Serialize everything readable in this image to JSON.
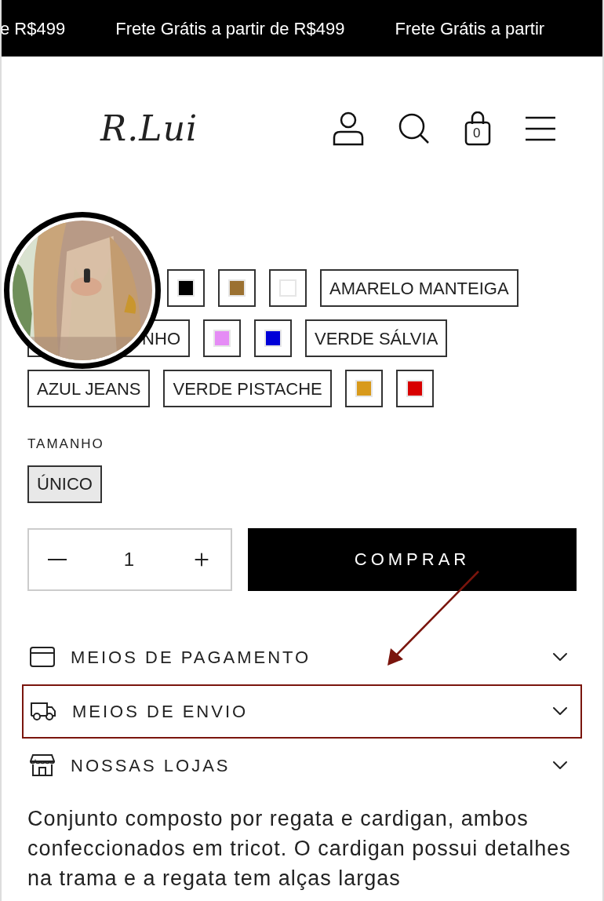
{
  "announcement_bar": {
    "messages": [
      "e R$499",
      "Frete Grátis a partir de R$499",
      "Frete Grátis a partir"
    ]
  },
  "header": {
    "logo": "R.Lui",
    "cart_count": "0"
  },
  "colors": {
    "rows": [
      [
        {
          "kind": "swatch",
          "color": "#000000",
          "selected": false
        },
        {
          "kind": "swatch",
          "color": "#9b7131",
          "selected": false
        },
        {
          "kind": "swatch",
          "color": "#ffffff",
          "selected": false
        },
        {
          "kind": "text",
          "label": "AMARELO MANTEIGA",
          "selected": false
        }
      ],
      [
        {
          "kind": "partial_text",
          "label": "NHO",
          "selected": false
        },
        {
          "kind": "swatch",
          "color": "#e58cf5",
          "selected": false
        },
        {
          "kind": "swatch",
          "color": "#0000d8",
          "selected": false
        },
        {
          "kind": "text",
          "label": "VERDE SÁLVIA",
          "selected": false
        }
      ],
      [
        {
          "kind": "text",
          "label": "AZUL JEANS",
          "selected": false
        },
        {
          "kind": "text",
          "label": "VERDE PISTACHE",
          "selected": false
        },
        {
          "kind": "swatch",
          "color": "#d89a1c",
          "selected": false
        },
        {
          "kind": "swatch",
          "color": "#d80000",
          "selected": false
        }
      ]
    ]
  },
  "size": {
    "label": "TAMANHO",
    "options": [
      {
        "label": "ÚNICO",
        "selected": true
      }
    ]
  },
  "quantity": {
    "value": "1"
  },
  "buy_button": "COMPRAR",
  "accordion": [
    {
      "kind": "payment",
      "label": "MEIOS DE PAGAMENTO",
      "expanded": false,
      "highlighted": false
    },
    {
      "kind": "shipping",
      "label": "MEIOS DE ENVIO",
      "expanded": false,
      "highlighted": true
    },
    {
      "kind": "stores",
      "label": "NOSSAS LOJAS",
      "expanded": false,
      "highlighted": false
    }
  ],
  "description": "Conjunto composto por regata e cardigan, ambos confeccionados em tricot. O cardigan possui detalhes na trama e a regata tem alças largas"
}
